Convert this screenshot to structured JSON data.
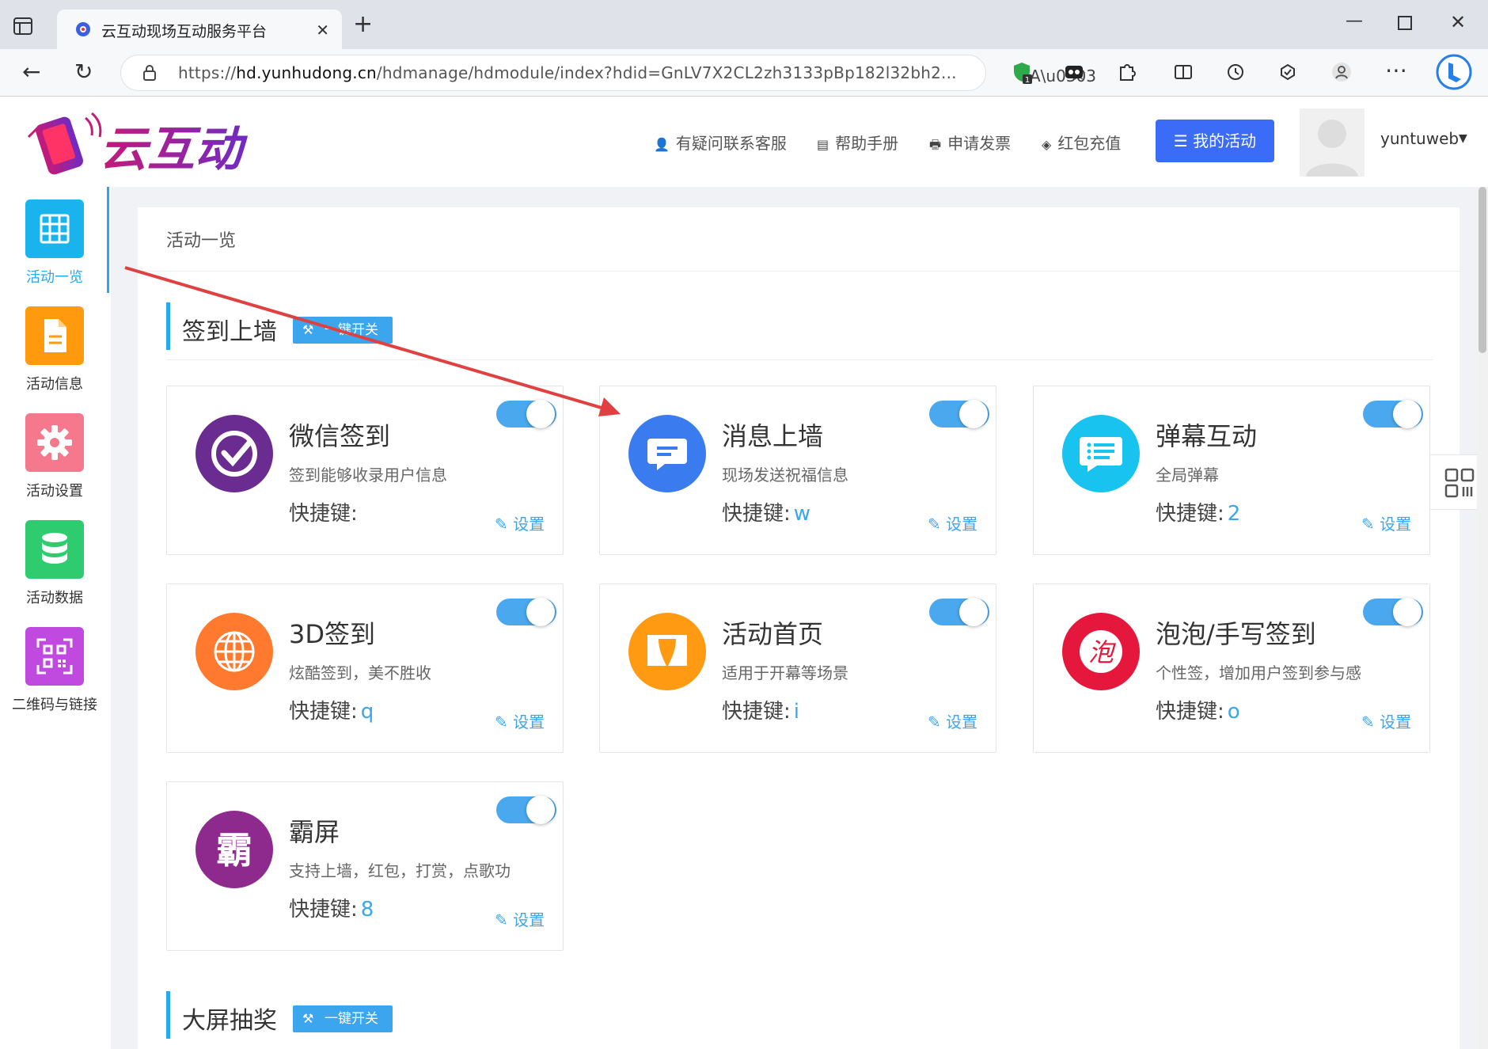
{
  "browser": {
    "tab_title": "云互动现场互动服务平台",
    "tab_close": "✕",
    "new_tab": "+",
    "url_prefix": "https://",
    "url_domain": "hd.yunhudong.cn",
    "url_path": "/hdmanage/hdmodule/index?hdid=GnLV7X2CL2zh3133pBp182l32bh2...",
    "read_aloud": "Ã",
    "extension_badge": "1"
  },
  "header": {
    "logo_text": "云互动",
    "nav": [
      {
        "icon": "person-add-icon",
        "glyph": "👤",
        "label": "有疑问联系客服"
      },
      {
        "icon": "book-icon",
        "glyph": "▤",
        "label": "帮助手册"
      },
      {
        "icon": "printer-icon",
        "glyph": "🖶",
        "label": "申请发票"
      },
      {
        "icon": "shield-check-icon",
        "glyph": "◈",
        "label": "红包充值"
      }
    ],
    "my_activity": "我的活动",
    "my_activity_glyph": "☰",
    "username": "yuntuweb",
    "caret": "▼"
  },
  "sidebar": {
    "items": [
      {
        "label": "活动一览",
        "icon": "grid-icon",
        "color": "#19b4ee"
      },
      {
        "label": "活动信息",
        "icon": "document-icon",
        "color": "#ff9a0e"
      },
      {
        "label": "活动设置",
        "icon": "gear-icon",
        "color": "#f6788c"
      },
      {
        "label": "活动数据",
        "icon": "database-icon",
        "color": "#2ecb6f"
      },
      {
        "label": "二维码与链接",
        "icon": "qrcode-icon",
        "color": "#c04ae0"
      }
    ]
  },
  "main": {
    "breadcrumb": "活动一览",
    "sections": [
      {
        "title": "签到上墙",
        "toggle_all": "一键开关"
      },
      {
        "title": "大屏抽奖",
        "toggle_all": "一键开关"
      }
    ],
    "key_label": "快捷键:",
    "settings_label": "设置",
    "cards": [
      {
        "title": "微信签到",
        "desc": "签到能够收录用户信息",
        "key": "",
        "enabled": true,
        "icon": "checkmark-circle-icon",
        "color": "#6b2c91"
      },
      {
        "title": "消息上墙",
        "desc": "现场发送祝福信息",
        "key": "w",
        "enabled": true,
        "icon": "message-bubble-icon",
        "color": "#3a7bf0"
      },
      {
        "title": "弹幕互动",
        "desc": "全局弹幕",
        "key": "2",
        "enabled": true,
        "icon": "chat-lines-icon",
        "color": "#19c3ef"
      },
      {
        "title": "3D签到",
        "desc": "炫酷签到，美不胜收",
        "key": "q",
        "enabled": true,
        "icon": "globe-icon",
        "color": "#ff7a2f"
      },
      {
        "title": "活动首页",
        "desc": "适用于开幕等场景",
        "key": "i",
        "enabled": true,
        "icon": "curtain-icon",
        "color": "#ff9a12"
      },
      {
        "title": "泡泡/手写签到",
        "desc": "个性签，增加用户签到参与感",
        "key": "o",
        "enabled": true,
        "icon": "bubble-char-icon",
        "color": "#e6173c",
        "char": "泡"
      },
      {
        "title": "霸屏",
        "desc": "支持上墙，红包，打赏，点歌功",
        "key": "8",
        "enabled": true,
        "icon": "bapin-char-icon",
        "color": "#8e2a8e",
        "char": "霸"
      }
    ]
  }
}
